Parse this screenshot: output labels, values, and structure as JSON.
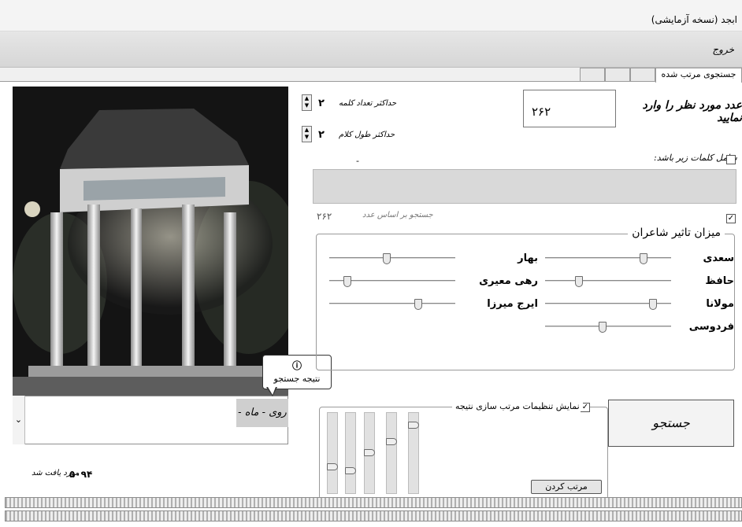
{
  "window": {
    "title": "ابجد (نسخه آزمایشی)"
  },
  "menu": {
    "exit_label": "خروج"
  },
  "tabs": [
    {
      "label": "جستجوی مرتب شده",
      "active": true
    },
    {
      "label": "",
      "active": false
    },
    {
      "label": "",
      "active": false
    },
    {
      "label": "",
      "active": false
    }
  ],
  "search": {
    "count_label": "عدد مورد نظر را وارد نمایید",
    "count_value": "۲۶۲",
    "max_words_label": "حداکثر تعداد کلمه",
    "max_words_value": "۲",
    "max_length_label": "حداکثر طول کلام",
    "max_length_value": "۲",
    "include_words_label": "شامل کلمات زیر باشد:",
    "include_words_checked": false,
    "dash": "-",
    "option_checked": true,
    "result_number": "۲۶۲",
    "result_hint": "جستجو بر اساس عدد"
  },
  "poets_group": {
    "title": "میزان تاثیر شاعران",
    "right_column": [
      {
        "label": "سعدی",
        "value": 0.8
      },
      {
        "label": "حافظ",
        "value": 0.25
      },
      {
        "label": "مولانا",
        "value": 0.88
      },
      {
        "label": "فردوسی",
        "value": 0.45
      }
    ],
    "left_column": [
      {
        "label": "بهار",
        "value": 0.45
      },
      {
        "label": "رهی معیری",
        "value": 0.12
      },
      {
        "label": "ایرج میرزا",
        "value": 0.72
      }
    ]
  },
  "sort_settings": {
    "show_label": "نمایش تنظیمات مرتب سازی نتیجه",
    "show_checked": true,
    "sliders": [
      0.3,
      0.25,
      0.5,
      0.65,
      0.88
    ],
    "sort_button": "مرتب کردن"
  },
  "search_button": "جستجو",
  "tooltip": {
    "icon": "info-icon",
    "text": "نتیجه جستجو"
  },
  "result_combo": {
    "selected": "روی - ماه -"
  },
  "footer": {
    "found_count": "۵۰۹۴",
    "found_label": "مورد یافت شد"
  },
  "colors": {
    "panel_gray": "#d9d9d9",
    "menu_bg": "#dcdcdc"
  }
}
